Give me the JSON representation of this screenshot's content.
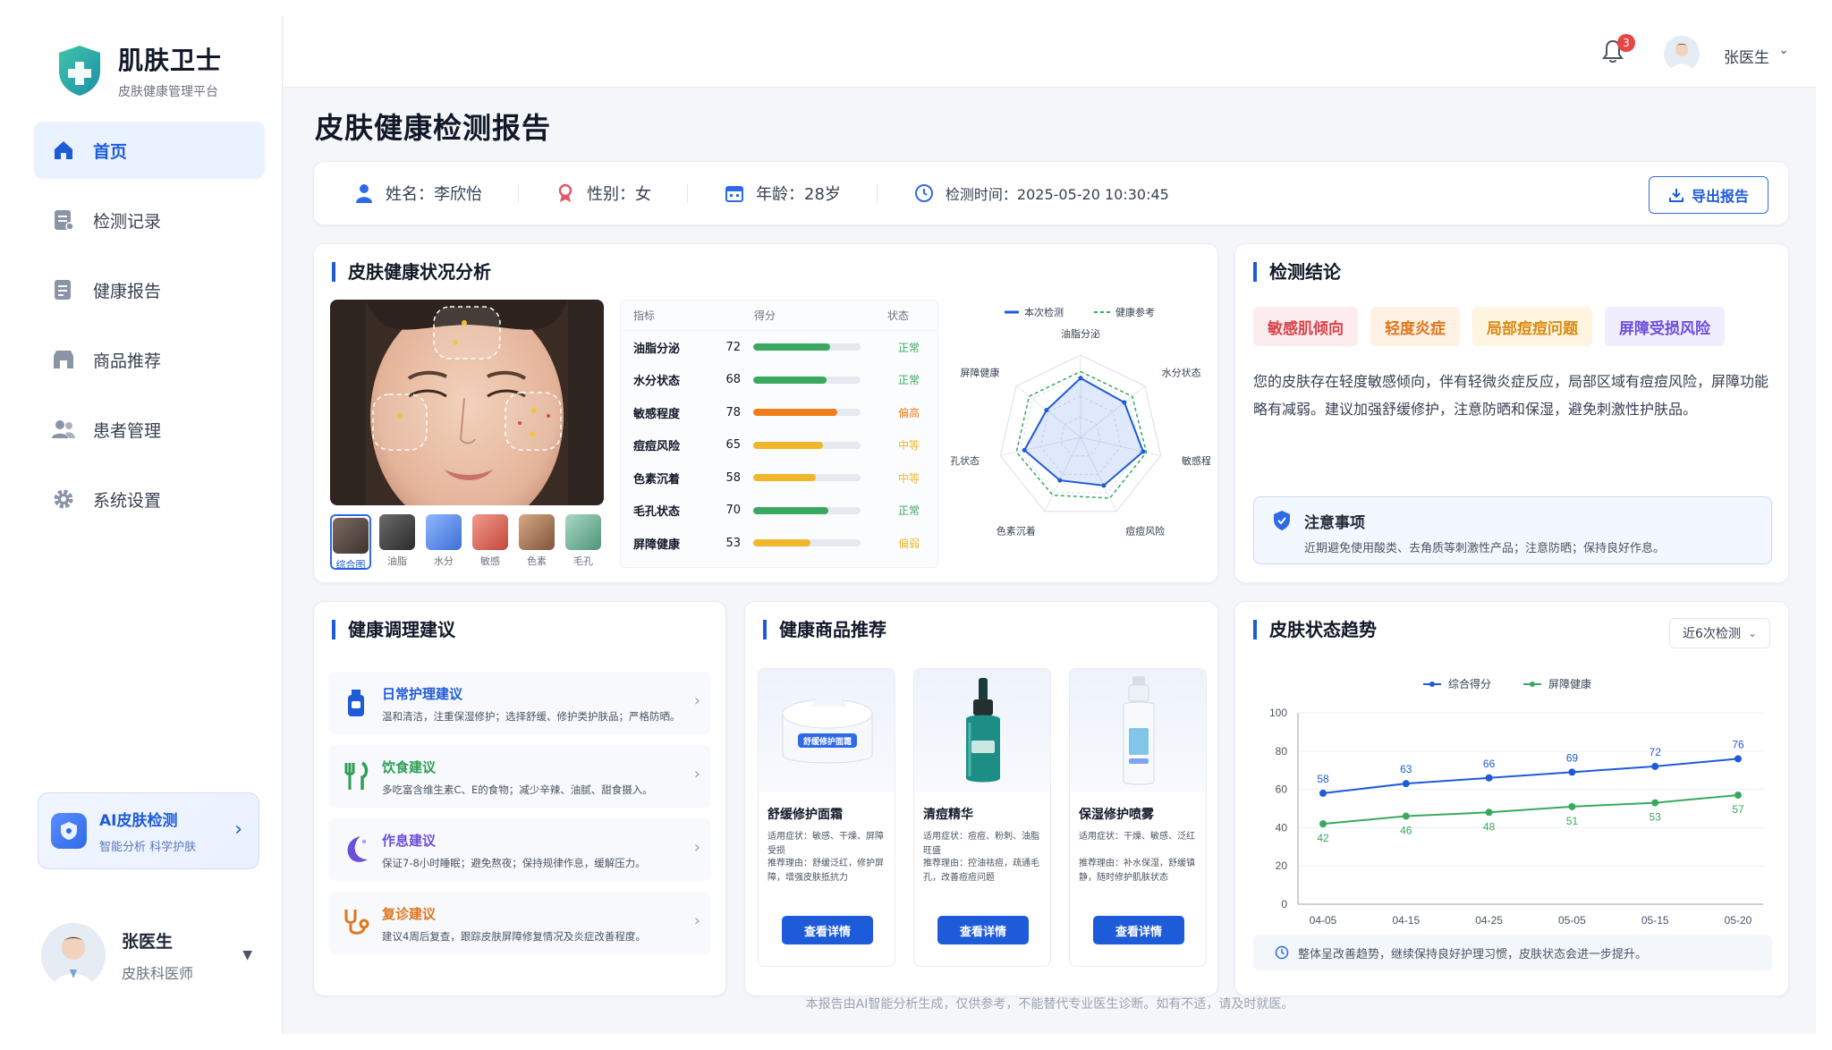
{
  "brand": {
    "title": "肌肤卫士",
    "subtitle": "皮肤健康管理平台"
  },
  "nav": [
    {
      "label": "首页",
      "icon": "home-icon",
      "active": true
    },
    {
      "label": "检测记录",
      "icon": "records-icon"
    },
    {
      "label": "健康报告",
      "icon": "report-icon"
    },
    {
      "label": "商品推荐",
      "icon": "shop-icon"
    },
    {
      "label": "患者管理",
      "icon": "patients-icon"
    },
    {
      "label": "系统设置",
      "icon": "gear-icon"
    }
  ],
  "ai_card": {
    "title": "AI皮肤检测",
    "subtitle": "智能分析  科学护肤"
  },
  "user": {
    "name": "张医生",
    "role": "皮肤科医师"
  },
  "topbar": {
    "badge": "3",
    "user": "张医生"
  },
  "page_title": "皮肤健康检测报告",
  "patient": {
    "name": "姓名：李欣怡",
    "gender": "性别：女",
    "age": "年龄：28岁",
    "time": "检测时间：2025-05-20 10:30:45",
    "export_label": "导出报告"
  },
  "analysis": {
    "title": "皮肤健康状况分析",
    "thumbs": [
      "综合图",
      "油脂",
      "水分",
      "敏感",
      "色素",
      "毛孔"
    ],
    "table_headers": [
      "指标",
      "得分",
      "状态"
    ],
    "rows": [
      {
        "name": "油脂分泌",
        "score": 72,
        "status": "正常",
        "color": "#3aa860"
      },
      {
        "name": "水分状态",
        "score": 68,
        "status": "正常",
        "color": "#3aa860"
      },
      {
        "name": "敏感程度",
        "score": 78,
        "status": "偏高",
        "color": "#ef7d1a"
      },
      {
        "name": "痘痘风险",
        "score": 65,
        "status": "中等",
        "color": "#f1b72c"
      },
      {
        "name": "色素沉着",
        "score": 58,
        "status": "中等",
        "color": "#f1b72c"
      },
      {
        "name": "毛孔状态",
        "score": 70,
        "status": "正常",
        "color": "#3aa860"
      },
      {
        "name": "屏障健康",
        "score": 53,
        "status": "偏弱",
        "color": "#f1b72c"
      }
    ],
    "radar_legend": [
      "本次检测",
      "健康参考"
    ],
    "radar_axes": [
      "油脂分泌",
      "水分状态",
      "敏感程度",
      "痘痘风险",
      "色素沉着",
      "毛孔状态",
      "屏障健康"
    ]
  },
  "conclusion": {
    "title": "检测结论",
    "tags": [
      {
        "label": "敏感肌倾向",
        "color": "#d9434a",
        "bg": "#fdecee"
      },
      {
        "label": "轻度炎症",
        "color": "#e0761c",
        "bg": "#fff1e3"
      },
      {
        "label": "局部痘痘问题",
        "color": "#d98a14",
        "bg": "#fff5e0"
      },
      {
        "label": "屏障受损风险",
        "color": "#6b4fd8",
        "bg": "#f0edff"
      }
    ],
    "text": "您的皮肤存在轻度敏感倾向，伴有轻微炎症反应，局部区域有痘痘风险，屏障功能略有减弱。建议加强舒缓修护，注意防晒和保湿，避免刺激性护肤品。",
    "notice_title": "注意事项",
    "notice_text": "近期避免使用酸类、去角质等刺激性产品；注意防晒；保持良好作息。"
  },
  "advice": {
    "title": "健康调理建议",
    "items": [
      {
        "title": "日常护理建议",
        "desc": "温和清洁，注重保湿修护；选择舒缓、修护类护肤品；严格防晒。",
        "color": "#1e5bd8"
      },
      {
        "title": "饮食建议",
        "desc": "多吃富含维生素C、E的食物；减少辛辣、油腻、甜食摄入。",
        "color": "#2e9e56"
      },
      {
        "title": "作息建议",
        "desc": "保证7-8小时睡眠；避免熬夜；保持规律作息，缓解压力。",
        "color": "#6b4fd8"
      },
      {
        "title": "复诊建议",
        "desc": "建议4周后复查，跟踪皮肤屏障修复情况及炎症改善程度。",
        "color": "#e0761c"
      }
    ]
  },
  "products": {
    "title": "健康商品推荐",
    "items": [
      {
        "name": "舒缓修护面霜",
        "symptom": "适用症状：敏感、干燥、屏障受损",
        "reason": "推荐理由：舒缓泛红，修护屏障，增强皮肤抵抗力",
        "button": "查看详情",
        "label": "舒缓修护面霜"
      },
      {
        "name": "清痘精华",
        "symptom": "适用症状：痘痘、粉刺、油脂旺盛",
        "reason": "推荐理由：控油祛痘，疏通毛孔，改善痘痘问题",
        "button": "查看详情"
      },
      {
        "name": "保湿修护喷雾",
        "symptom": "适用症状：干燥、敏感、泛红",
        "reason": "推荐理由：补水保湿，舒缓镇静，随时修护肌肤状态",
        "button": "查看详情"
      }
    ]
  },
  "trend": {
    "title": "皮肤状态趋势",
    "select": "近6次检测",
    "note": "整体呈改善趋势，继续保持良好护理习惯，皮肤状态会进一步提升。"
  },
  "chart_data": {
    "type": "line",
    "x": [
      "04-05",
      "04-15",
      "04-25",
      "05-05",
      "05-15",
      "05-20"
    ],
    "series": [
      {
        "name": "综合得分",
        "values": [
          58,
          63,
          66,
          69,
          72,
          76
        ],
        "color": "#1e5bd8"
      },
      {
        "name": "屏障健康",
        "values": [
          42,
          46,
          48,
          51,
          53,
          57
        ],
        "color": "#3aa860"
      }
    ],
    "ylim": [
      0,
      100
    ],
    "yticks": [
      0,
      20,
      40,
      60,
      80,
      100
    ],
    "grid": true,
    "legend": "top"
  },
  "radar_data": {
    "current": [
      72,
      68,
      78,
      65,
      58,
      70,
      53
    ],
    "reference": [
      80,
      80,
      82,
      82,
      78,
      80,
      80
    ]
  },
  "footer": "本报告由AI智能分析生成，仅供参考，不能替代专业医生诊断。如有不适，请及时就医。"
}
